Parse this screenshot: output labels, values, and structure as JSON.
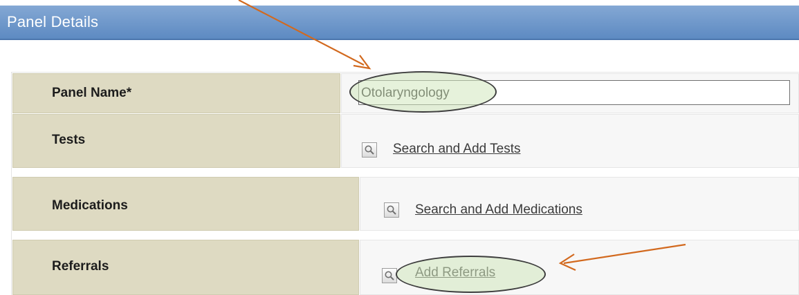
{
  "header": {
    "title": "Panel Details"
  },
  "form": {
    "panel_name_label": "Panel Name*",
    "panel_name_value": "Otolaryngology",
    "tests_label": "Tests",
    "tests_link": "Search and Add Tests",
    "medications_label": "Medications",
    "medications_link": "Search and Add Medications",
    "referrals_label": "Referrals",
    "referrals_link": "Add Referrals"
  },
  "icons": {
    "search": "magnifier-icon",
    "annotation": "arrow-icon"
  },
  "colors": {
    "header_blue": "#6b95c9",
    "label_cell": "#dedac2",
    "annotation_arrow": "#d2691e",
    "highlight_oval": "#d2e8be"
  }
}
